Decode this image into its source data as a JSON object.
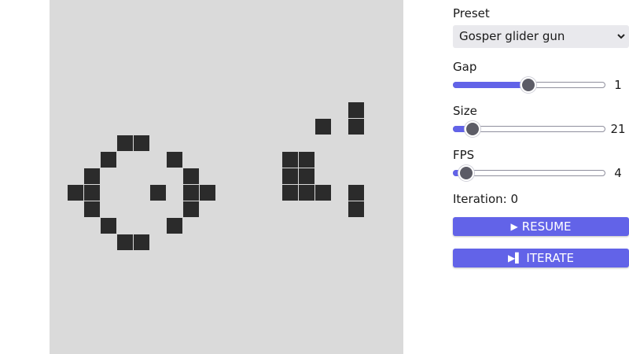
{
  "controls": {
    "preset": {
      "label": "Preset",
      "value": "Gosper glider gun"
    },
    "gap": {
      "label": "Gap",
      "value": "1",
      "fraction": 0.5
    },
    "size": {
      "label": "Size",
      "value": "21",
      "fraction": 0.13
    },
    "fps": {
      "label": "FPS",
      "value": "4",
      "fraction": 0.09
    }
  },
  "iteration": {
    "text": "Iteration: 0"
  },
  "buttons": {
    "resume": {
      "icon": "play-icon",
      "label": "RESUME"
    },
    "iterate": {
      "icon": "step-forward-icon",
      "label": "ITERATE"
    }
  },
  "board": {
    "alive_color": "#2b2b2b",
    "dead_color": "#dadada",
    "live_cells": [
      [
        4,
        8
      ],
      [
        5,
        8
      ],
      [
        3,
        9
      ],
      [
        7,
        9
      ],
      [
        2,
        10
      ],
      [
        8,
        10
      ],
      [
        1,
        11
      ],
      [
        2,
        11
      ],
      [
        6,
        11
      ],
      [
        8,
        11
      ],
      [
        9,
        11
      ],
      [
        2,
        12
      ],
      [
        8,
        12
      ],
      [
        3,
        13
      ],
      [
        7,
        13
      ],
      [
        4,
        14
      ],
      [
        5,
        14
      ],
      [
        14,
        9
      ],
      [
        15,
        9
      ],
      [
        14,
        10
      ],
      [
        15,
        10
      ],
      [
        14,
        11
      ],
      [
        15,
        11
      ],
      [
        16,
        7
      ],
      [
        16,
        11
      ],
      [
        18,
        6
      ],
      [
        18,
        7
      ],
      [
        18,
        11
      ],
      [
        18,
        12
      ]
    ]
  },
  "colors": {
    "accent": "#6263e8",
    "thumb": "#5c5c66",
    "select_bg": "#e9e9ed"
  }
}
